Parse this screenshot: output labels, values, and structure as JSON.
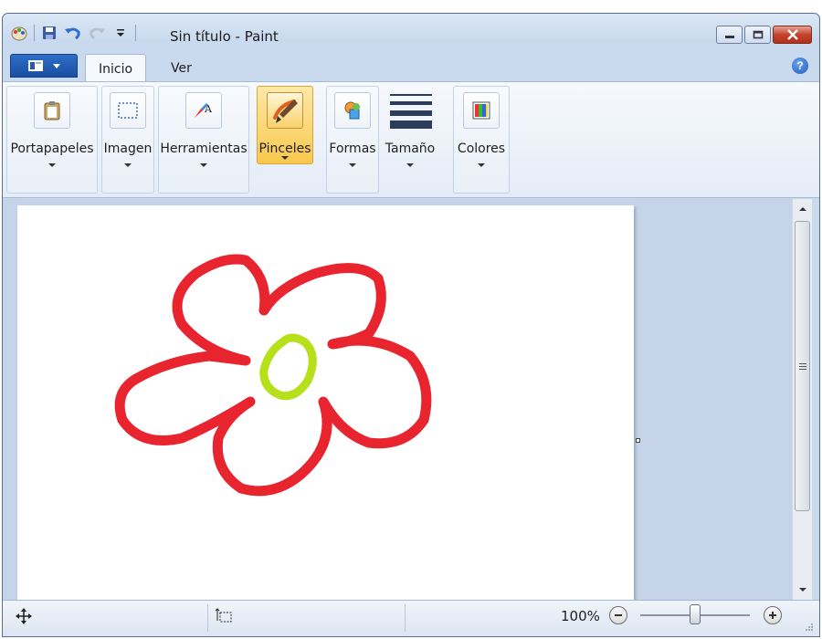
{
  "window": {
    "title": "Sin título - Paint"
  },
  "ribbon": {
    "tabs": [
      {
        "label": "Inicio",
        "active": true
      },
      {
        "label": "Ver",
        "active": false
      }
    ],
    "groups": [
      {
        "label": "Portapapeles",
        "icon": "clipboard-icon"
      },
      {
        "label": "Imagen",
        "icon": "select-icon"
      },
      {
        "label": "Herramientas",
        "icon": "tools-icon"
      },
      {
        "label": "Pinceles",
        "icon": "brush-icon",
        "selected": true
      },
      {
        "label": "Formas",
        "icon": "shapes-icon"
      },
      {
        "label": "Tamaño",
        "icon": "line-size-icon"
      },
      {
        "label": "Colores",
        "icon": "colors-icon"
      }
    ]
  },
  "status": {
    "zoom": "100%",
    "zoom_level": 1.0
  },
  "colors": {
    "flower_petals": "#e8242e",
    "flower_center": "#b6e01a",
    "selected_group": "#f9c84c"
  }
}
